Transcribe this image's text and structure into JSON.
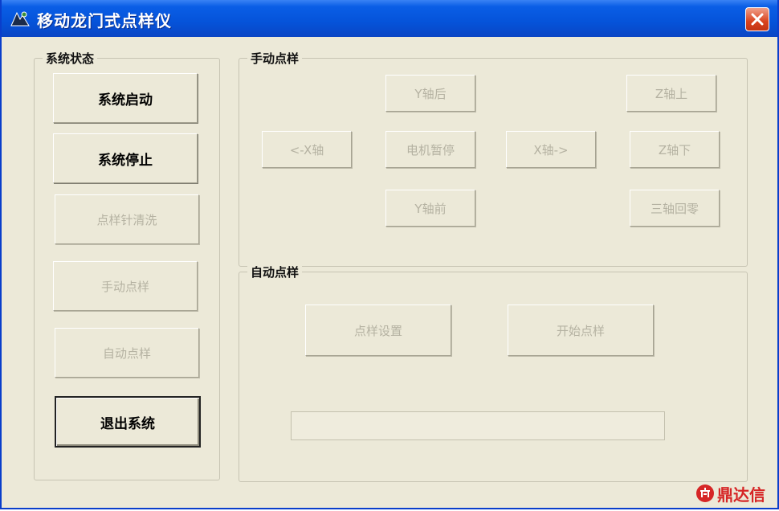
{
  "window": {
    "title": "移动龙门式点样仪"
  },
  "system_status": {
    "legend": "系统状态",
    "buttons": {
      "start": "系统启动",
      "stop": "系统停止",
      "clean": "点样针清洗",
      "manual": "手动点样",
      "auto": "自动点样",
      "exit": "退出系统"
    }
  },
  "manual_sampling": {
    "legend": "手动点样",
    "buttons": {
      "y_back": "Y轴后",
      "z_up": "Z轴上",
      "x_left": "<-X轴",
      "motor_pause": "电机暂停",
      "x_right": "X轴->",
      "z_down": "Z轴下",
      "y_front": "Y轴前",
      "three_axis_zero": "三轴回零"
    }
  },
  "auto_sampling": {
    "legend": "自动点样",
    "buttons": {
      "settings": "点样设置",
      "start": "开始点样"
    },
    "progress": 0
  },
  "watermark": {
    "text": "鼎达信"
  },
  "colors": {
    "title_bar": "#0553d9",
    "window_bg": "#ece9d8",
    "close_button": "#d9431e",
    "disabled_text": "#b5b2a2",
    "watermark": "#d62626"
  }
}
